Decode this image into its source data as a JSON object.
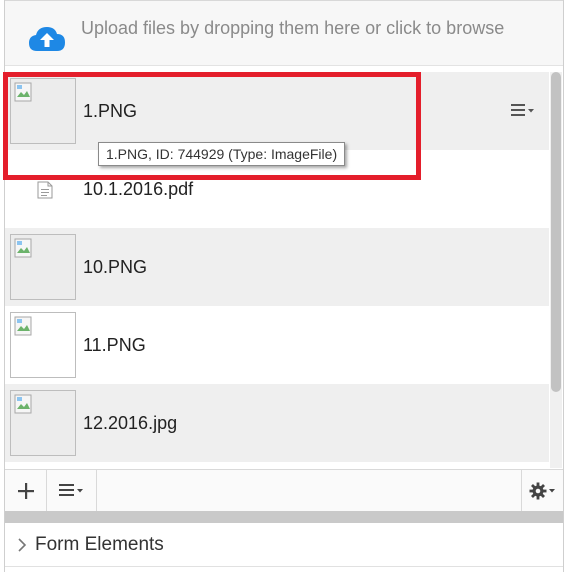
{
  "upload": {
    "text": "Upload files by dropping them here or click to browse",
    "icon": "cloud-upload-icon",
    "icon_color": "#1e88e5"
  },
  "files": [
    {
      "name": "1.PNG",
      "kind": "image",
      "icon": "broken-image-icon"
    },
    {
      "name": "10.1.2016.pdf",
      "kind": "document",
      "icon": "document-icon"
    },
    {
      "name": "10.PNG",
      "kind": "image",
      "icon": "broken-image-icon"
    },
    {
      "name": "11.PNG",
      "kind": "image",
      "icon": "broken-image-icon"
    },
    {
      "name": "12.2016.jpg",
      "kind": "image",
      "icon": "broken-image-icon"
    }
  ],
  "tooltip": {
    "text": "1.PNG, ID: 744929 (Type: ImageFile)"
  },
  "toolbar": {
    "add_icon": "plus-icon",
    "menu_icon": "list-menu-icon",
    "settings_icon": "gear-icon"
  },
  "section": {
    "label": "Form Elements",
    "icon": "chevron-right-icon"
  },
  "colors": {
    "highlight": "#e41e2b",
    "row_alt": "#efefef"
  }
}
